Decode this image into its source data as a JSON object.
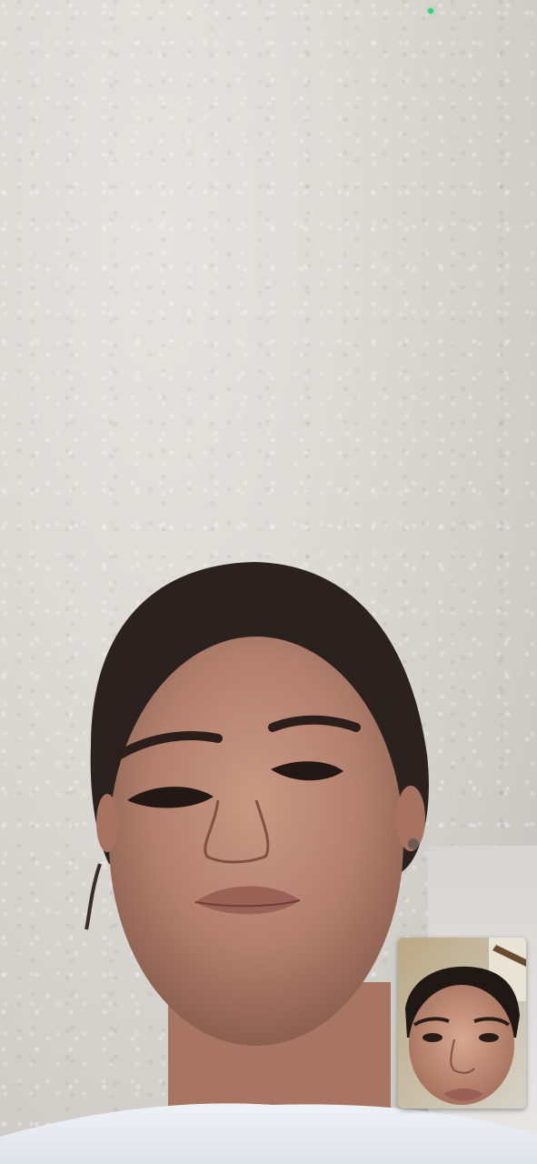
{
  "call": {
    "camera_indicator_color": "#2bd66b",
    "remote_video_icon": "remote-participant-video",
    "self_view_icon": "self-preview-video"
  }
}
